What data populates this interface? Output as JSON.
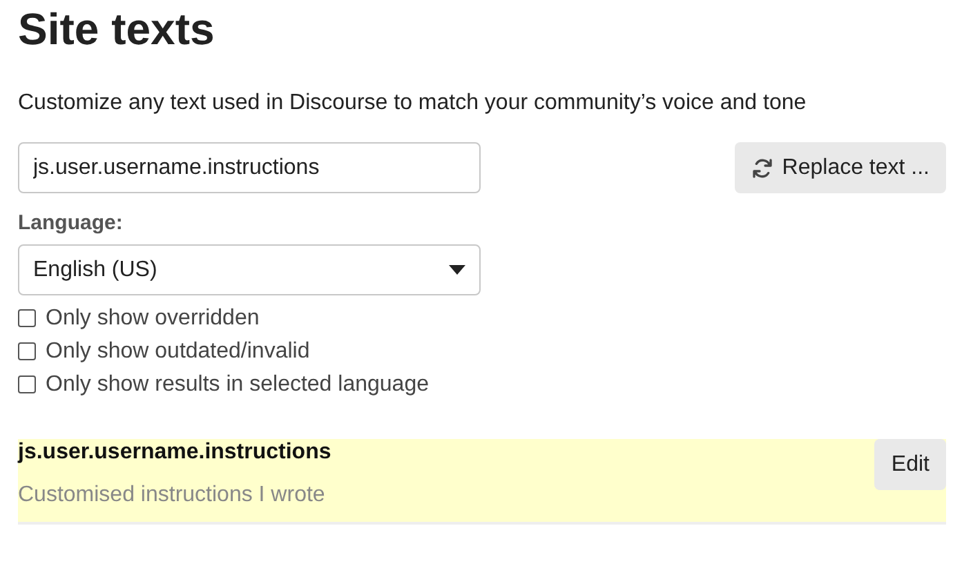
{
  "title": "Site texts",
  "description": "Customize any text used in Discourse to match your community’s voice and tone",
  "search": {
    "value": "js.user.username.instructions"
  },
  "replace_button": {
    "label": "Replace text ..."
  },
  "language": {
    "label": "Language:",
    "value": "English (US)"
  },
  "filters": [
    {
      "label": "Only show overridden",
      "checked": false
    },
    {
      "label": "Only show outdated/invalid",
      "checked": false
    },
    {
      "label": "Only show results in selected language",
      "checked": false
    }
  ],
  "results": [
    {
      "key": "js.user.username.instructions",
      "value": "Customised instructions I wrote",
      "overridden": true,
      "button": "Edit"
    }
  ]
}
